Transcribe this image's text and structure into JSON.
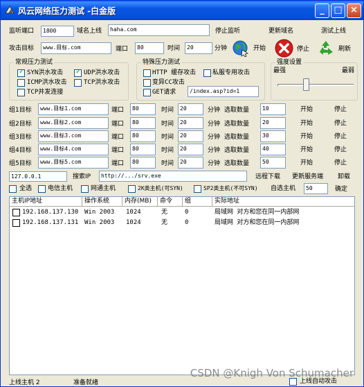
{
  "window": {
    "title": "风云网络压力测试 -白金版",
    "minimize": "_",
    "maximize": "□",
    "close": "×"
  },
  "top": {
    "listen_port_label": "监听端口",
    "listen_port": "1800",
    "domain_label": "域名上线",
    "domain": "haha.com",
    "stop_listen": "停止监听",
    "update_domain": "更新域名",
    "test_online": "测试上线",
    "target_label": "攻击目标",
    "target": "www.目标.com",
    "port_label": "端口",
    "port": "80",
    "time_label": "时间",
    "time": "20",
    "minutes_label": "分钟",
    "start_label": "开始",
    "stop_label": "停止",
    "refresh_label": "刷新"
  },
  "normal_group": {
    "title": "常规压力测试",
    "items": [
      {
        "label": "SYN洪水攻击",
        "checked": true
      },
      {
        "label": "UDP洪水攻击",
        "checked": true
      },
      {
        "label": "ICMP洪水攻击",
        "checked": false
      },
      {
        "label": "TCP洪水攻击",
        "checked": false
      },
      {
        "label": "TCP并发连接",
        "checked": false
      }
    ]
  },
  "special_group": {
    "title": "特殊压力测试",
    "items": [
      {
        "label": "HTTP 缓存攻击",
        "checked": false
      },
      {
        "label": "私服专用攻击",
        "checked": false
      },
      {
        "label": "变异CC攻击",
        "checked": false
      },
      {
        "label": "GET请求",
        "checked": false
      }
    ],
    "get_path": "/index.asp?id=1"
  },
  "strength_group": {
    "title": "强度设置",
    "strongest": "最强",
    "weakest": "最弱",
    "level": 0.4
  },
  "groups": [
    {
      "label": "组1目标",
      "target": "www.目标1.com",
      "port_label": "端口",
      "port": "80",
      "time_label": "时间",
      "time": "20",
      "minutes": "分钟",
      "count_label": "选取数量",
      "count": "10",
      "start": "开始",
      "stop": "停止"
    },
    {
      "label": "组2目标",
      "target": "www.目标2.com",
      "port_label": "端口",
      "port": "80",
      "time_label": "时间",
      "time": "20",
      "minutes": "分钟",
      "count_label": "选取数量",
      "count": "20",
      "start": "开始",
      "stop": "停止"
    },
    {
      "label": "组3目标",
      "target": "www.目标3.com",
      "port_label": "端口",
      "port": "80",
      "time_label": "时间",
      "time": "20",
      "minutes": "分钟",
      "count_label": "选取数量",
      "count": "30",
      "start": "开始",
      "stop": "停止"
    },
    {
      "label": "组4目标",
      "target": "www.目标4.com",
      "port_label": "端口",
      "port": "80",
      "time_label": "时间",
      "time": "20",
      "minutes": "分钟",
      "count_label": "选取数量",
      "count": "40",
      "start": "开始",
      "stop": "停止"
    },
    {
      "label": "组5目标",
      "target": "www.目标5.com",
      "port_label": "端口",
      "port": "80",
      "time_label": "时间",
      "time": "20",
      "minutes": "分钟",
      "count_label": "选取数量",
      "count": "50",
      "start": "开始",
      "stop": "停止"
    }
  ],
  "search": {
    "ip": "127.0.0.1",
    "search_ip": "搜索IP",
    "url": "http://.../srv.exe",
    "remote_download": "远程下载",
    "update_service": "更新服务端",
    "uninstall": "卸载"
  },
  "filters": {
    "select_all": "全选",
    "telecom": "电信主机",
    "netcom": "网通主机",
    "class_2k": "2K类主机(可SYN)",
    "class_sp2": "SP2类主机(不可SYN)",
    "custom_select": "自选主机",
    "custom_count": "50",
    "confirm": "确定"
  },
  "table": {
    "columns": [
      "主机IP地址",
      "操作系统",
      "内存(MB)",
      "命令",
      "组",
      "实际地址"
    ],
    "rows": [
      {
        "ip": "192.168.137.130",
        "os": "Win 2003",
        "mem": "1024",
        "cmd": "无",
        "group": "0",
        "addr": "局域网 对方和您在同一内部网"
      },
      {
        "ip": "192.168.137.131",
        "os": "Win 2003",
        "mem": "1024",
        "cmd": "无",
        "group": "0",
        "addr": "局域网 对方和您在同一内部网"
      }
    ]
  },
  "status": {
    "online_hosts": "上线主机 2",
    "ready": "准备就绪",
    "auto_attack": "上线自动攻击"
  },
  "watermark": "CSDN @Knigh Von Schumacher",
  "colors": {
    "titlebar": "#0856E2",
    "window_bg": "#ECE9D8",
    "input_border": "#7F9DB9"
  }
}
